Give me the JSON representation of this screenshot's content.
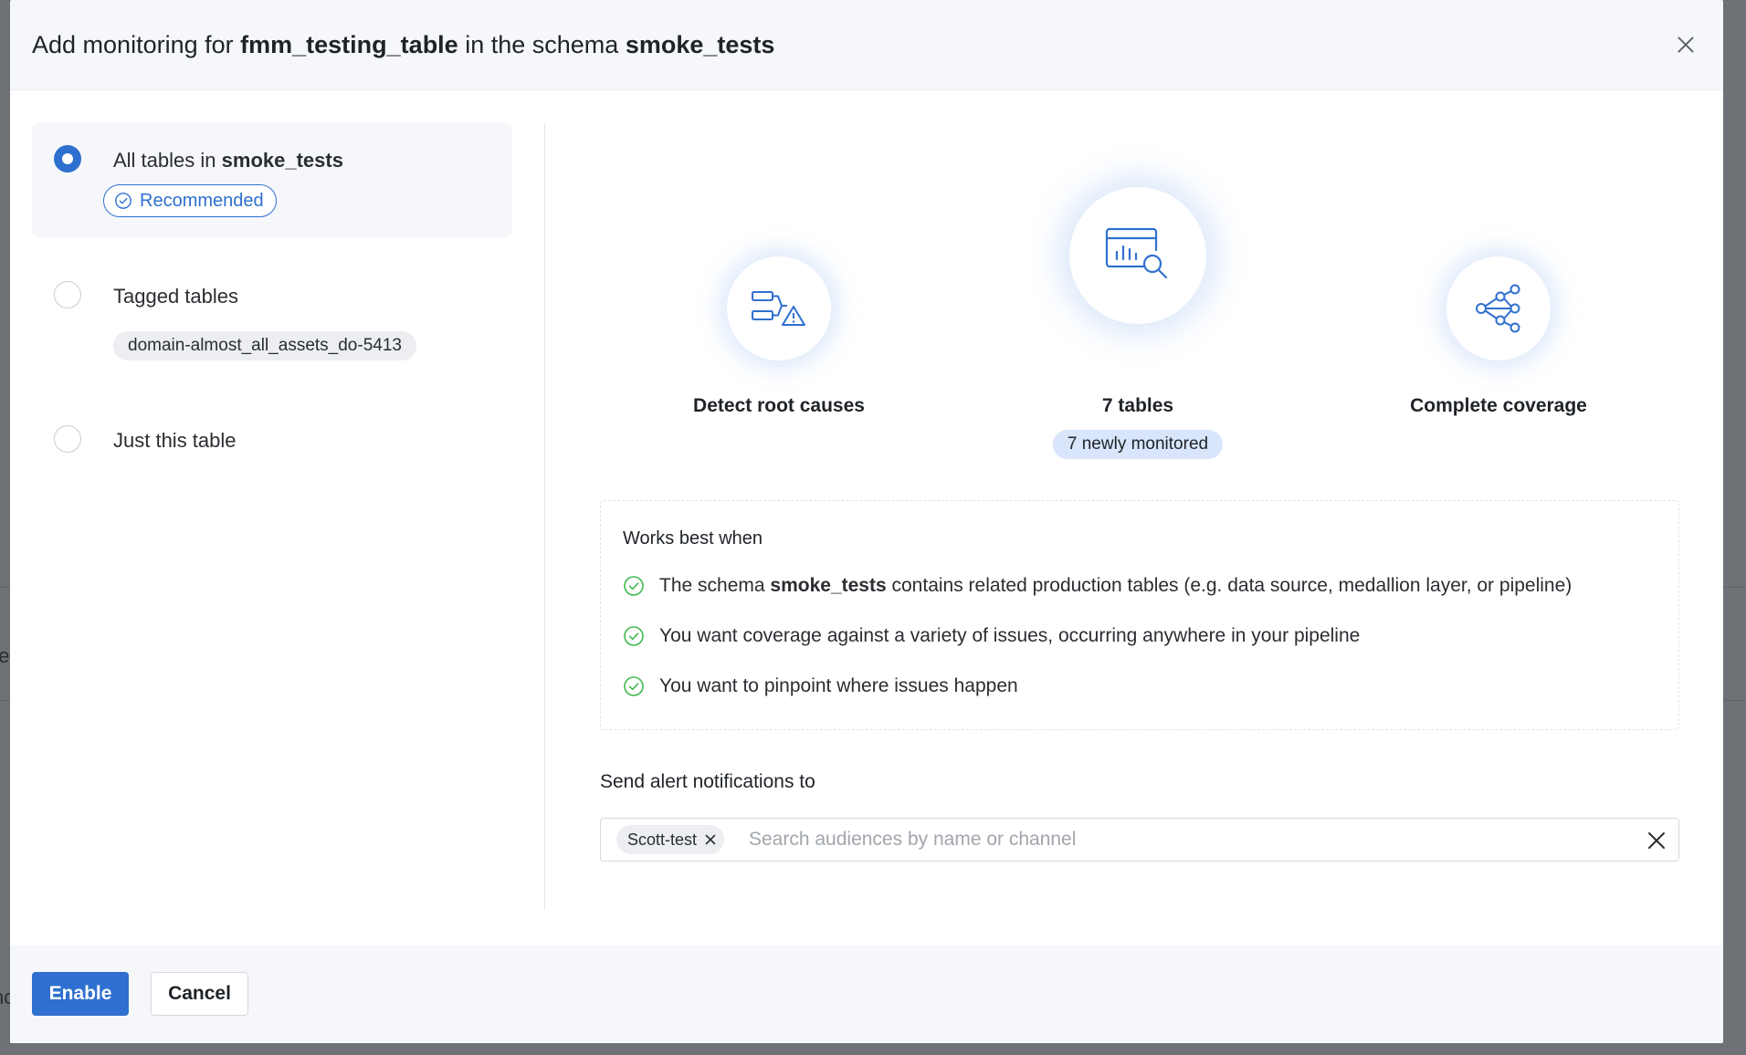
{
  "backdrop": {
    "fragment_1": "te",
    "fragment_2": "nc"
  },
  "header": {
    "title_prefix": "Add monitoring for",
    "table_name": "fmm_testing_table",
    "title_middle": "in the schema",
    "schema_name": "smoke_tests"
  },
  "options": {
    "all_tables": {
      "label_prefix": "All tables in",
      "schema": "smoke_tests",
      "badge": "Recommended",
      "selected": true
    },
    "tagged_tables": {
      "label": "Tagged tables",
      "tag": "domain-almost_all_assets_do-5413",
      "selected": false
    },
    "just_this_table": {
      "label": "Just this table",
      "selected": false
    }
  },
  "features": {
    "root_causes": {
      "title": "Detect root causes",
      "icon": "root-cause-icon"
    },
    "tables": {
      "title": "7 tables",
      "badge": "7 newly monitored",
      "icon": "table-search-icon"
    },
    "coverage": {
      "title": "Complete coverage",
      "icon": "network-share-icon"
    }
  },
  "works_best": {
    "title": "Works best when",
    "item1_prefix": "The schema",
    "item1_schema": "smoke_tests",
    "item1_suffix": "contains related production tables (e.g. data source, medallion layer, or pipeline)",
    "item2": "You want coverage against a variety of issues, occurring anywhere in your pipeline",
    "item3": "You want to pinpoint where issues happen"
  },
  "alerts": {
    "label": "Send alert notifications to",
    "selected_audience": "Scott-test",
    "placeholder": "Search audiences by name or channel",
    "value": ""
  },
  "footer": {
    "enable_label": "Enable",
    "cancel_label": "Cancel"
  },
  "colors": {
    "accent": "#2f6fcf",
    "success": "#3fb950",
    "badge_bg": "#d8e5fa",
    "panel_bg": "#f6f7fa"
  }
}
